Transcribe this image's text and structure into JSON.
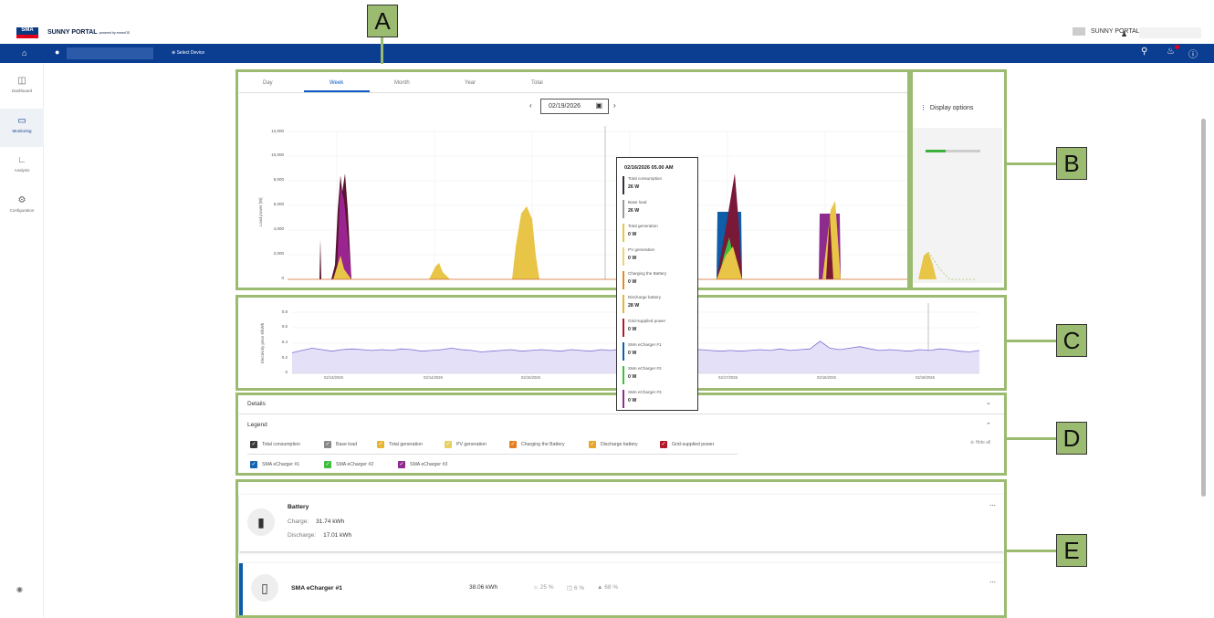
{
  "header": {
    "logo_text": "SMA",
    "brand": "SUNNY PORTAL",
    "brand_sub": "powered by ennexOS",
    "portal_link": "SUNNY PORTAL"
  },
  "navbar": {
    "select_device": "Select Device"
  },
  "sidebar": {
    "items": [
      {
        "label": "Dashboard",
        "icon": "dashboard-icon"
      },
      {
        "label": "Monitoring",
        "icon": "monitor-icon"
      },
      {
        "label": "Analysis",
        "icon": "analysis-icon"
      },
      {
        "label": "Configuration",
        "icon": "gear-icon"
      }
    ]
  },
  "tabs": [
    "Day",
    "Week",
    "Month",
    "Year",
    "Total"
  ],
  "active_tab": "Week",
  "date": "02/19/2026",
  "display_options": "Display options",
  "chart_data": {
    "type": "area",
    "ylabel": "Load power [W]",
    "yticks": [
      "12,000",
      "10,000",
      "8,000",
      "6,000",
      "4,000",
      "2,000",
      "0"
    ],
    "ylim": [
      0,
      12000
    ],
    "price_ylabel": "Electricity price €/kWh",
    "price_yticks": [
      "0.8",
      "0.6",
      "0.4",
      "0.2",
      "0"
    ],
    "price_ylim": [
      0,
      0.8
    ],
    "x_dates": [
      "02/13/2026",
      "02/14/2026",
      "02/15/2026",
      "02/16/2026",
      "02/17/2026",
      "02/18/2026",
      "02/19/2026"
    ],
    "price_series": [
      0.27,
      0.3,
      0.33,
      0.31,
      0.29,
      0.31,
      0.32,
      0.31,
      0.3,
      0.31,
      0.3,
      0.32,
      0.31,
      0.29,
      0.3,
      0.31,
      0.33,
      0.31,
      0.3,
      0.28,
      0.29,
      0.3,
      0.31,
      0.29,
      0.3,
      0.31,
      0.3,
      0.29,
      0.31,
      0.3,
      0.29,
      0.31,
      0.3,
      0.32,
      0.3,
      0.29,
      0.3,
      0.31,
      0.3,
      0.29,
      0.3,
      0.31,
      0.3,
      0.29,
      0.3,
      0.29,
      0.3,
      0.31,
      0.3,
      0.32,
      0.3,
      0.31,
      0.32,
      0.42,
      0.33,
      0.31,
      0.33,
      0.35,
      0.32,
      0.3,
      0.31,
      0.3,
      0.29,
      0.31,
      0.3,
      0.32,
      0.31,
      0.29,
      0.28,
      0.3
    ]
  },
  "tooltip": {
    "title": "02/16/2026 05.00 AM",
    "items": [
      {
        "name": "Total consumption",
        "value": "26 W",
        "color": "#3b2a3f"
      },
      {
        "name": "Base load",
        "value": "26 W",
        "color": "#999999"
      },
      {
        "name": "Total generation",
        "value": "0 W",
        "color": "#e8c547"
      },
      {
        "name": "PV generation",
        "value": "0 W",
        "color": "#e9d56b"
      },
      {
        "name": "Charging the Battery",
        "value": "0 W",
        "color": "#e88a2a"
      },
      {
        "name": "Discharge battery",
        "value": "28 W",
        "color": "#e5b53a"
      },
      {
        "name": "Grid-supplied power",
        "value": "0 W",
        "color": "#b0182a"
      },
      {
        "name": "SMA eCharger #1",
        "value": "0 W",
        "color": "#0e5da8"
      },
      {
        "name": "SMA eCharger #2",
        "value": "0 W",
        "color": "#3bbf3b"
      },
      {
        "name": "SMA eCharger #3",
        "value": "0 W",
        "color": "#8e2b8e"
      }
    ]
  },
  "details": "Details",
  "legend": {
    "title": "Legend",
    "hide_all": "Hide all",
    "items": [
      {
        "label": "Total consumption",
        "color": "#3a3a3a"
      },
      {
        "label": "Base load",
        "color": "#8a8a8a"
      },
      {
        "label": "Total generation",
        "color": "#e8b530"
      },
      {
        "label": "PV generation",
        "color": "#e7cf60"
      },
      {
        "label": "Charging the Battery",
        "color": "#e57d22"
      },
      {
        "label": "Discharge battery",
        "color": "#e5a629"
      },
      {
        "label": "Grid-supplied power",
        "color": "#b0182a"
      },
      {
        "label": "SMA eCharger #1",
        "color": "#1464b4"
      },
      {
        "label": "SMA eCharger #2",
        "color": "#3ebd3e"
      },
      {
        "label": "SMA eCharger #3",
        "color": "#8e2b8e"
      }
    ]
  },
  "battery": {
    "title": "Battery",
    "charge_label": "Charge:",
    "charge_value": "31.74 kWh",
    "discharge_label": "Discharge:",
    "discharge_value": "17.01 kWh"
  },
  "echarger": {
    "title": "SMA eCharger #1",
    "energy": "38.06 kWh",
    "pv_share": "25 %",
    "battery_share": "6 %",
    "grid_share": "68 %"
  },
  "annotations": [
    "A",
    "B",
    "C",
    "D",
    "E"
  ]
}
